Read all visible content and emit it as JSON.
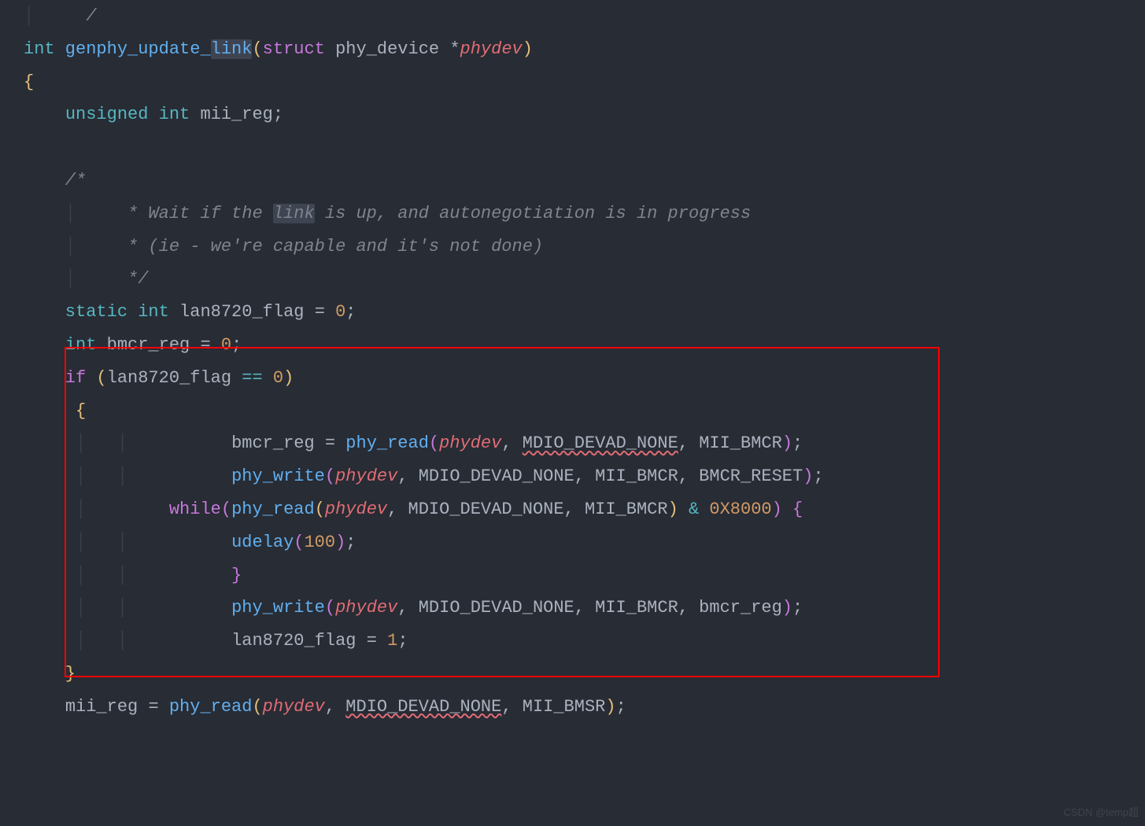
{
  "code": {
    "line0": "   /",
    "line1_int": "int",
    "line1_func": " genphy_update_",
    "line1_link": "link",
    "line1_p1": "(",
    "line1_struct": "struct",
    "line1_type": " phy_device ",
    "line1_star": "*",
    "line1_param": "phydev",
    "line1_p2": ")",
    "line2": "{",
    "line3_indent": "    ",
    "line3_unsigned": "unsigned int",
    "line3_var": " mii_reg",
    "line3_semi": ";",
    "line5_c": "    /*",
    "line6_c_pre": "     * Wait if the ",
    "line6_c_link": "link",
    "line6_c_post": " is up, and autonegotiation is in progress",
    "line7_c": "     * (ie - we're capable and it's not done)",
    "line8_c": "     */",
    "line9_static": "    static int",
    "line9_var": " lan8720_flag ",
    "line9_eq": "= ",
    "line9_num": "0",
    "line9_semi": ";",
    "line10_int": "    int",
    "line10_var": " bmcr_reg ",
    "line10_eq": "= ",
    "line10_num": "0",
    "line10_semi": ";",
    "line11_if": "    if ",
    "line11_p1": "(",
    "line11_var": "lan8720_flag ",
    "line11_eq": "== ",
    "line11_num": "0",
    "line11_p2": ")",
    "line12": "     {",
    "line13_indent": "          ",
    "line13_var": "bmcr_reg ",
    "line13_eq": "= ",
    "line13_func": "phy_read",
    "line13_p1": "(",
    "line13_param": "phydev",
    "line13_c1": ", ",
    "line13_const1": "MDIO_DEVAD_NONE",
    "line13_c2": ", ",
    "line13_const2": "MII_BMCR",
    "line13_p2": ")",
    "line13_semi": ";",
    "line14_indent": "          ",
    "line14_func": "phy_write",
    "line14_p1": "(",
    "line14_param": "phydev",
    "line14_c1": ", MDIO_DEVAD_NONE, MII_BMCR, BMCR_RESET",
    "line14_p2": ")",
    "line14_semi": ";",
    "line15_indent": "       ",
    "line15_while": "while",
    "line15_p1": "(",
    "line15_func": "phy_read",
    "line15_p2": "(",
    "line15_param": "phydev",
    "line15_c1": ", MDIO_DEVAD_NONE, MII_BMCR",
    "line15_p3": ")",
    "line15_amp": " & ",
    "line15_hex": "0X8000",
    "line15_p4": ")",
    "line15_brace": " {",
    "line16_indent": "          ",
    "line16_func": "udelay",
    "line16_p1": "(",
    "line16_num": "100",
    "line16_p2": ")",
    "line16_semi": ";",
    "line17": "          }",
    "line18_indent": "          ",
    "line18_func": "phy_write",
    "line18_p1": "(",
    "line18_param": "phydev",
    "line18_c1": ", MDIO_DEVAD_NONE, MII_BMCR, bmcr_reg",
    "line18_p2": ")",
    "line18_semi": ";",
    "line19_indent": "          ",
    "line19_var": "lan8720_flag ",
    "line19_eq": "= ",
    "line19_num": "1",
    "line19_semi": ";",
    "line20": "    }",
    "line21_indent": "    ",
    "line21_var": "mii_reg ",
    "line21_eq": "= ",
    "line21_func": "phy_read",
    "line21_p1": "(",
    "line21_param": "phydev",
    "line21_c1": ", ",
    "line21_const1": "MDIO_DEVAD_NONE",
    "line21_c2": ", MII_BMSR",
    "line21_p2": ")",
    "line21_semi": ";"
  },
  "watermark": "CSDN @temp超",
  "function_name": "genphy_update_link",
  "highlighted_word": "link",
  "red_box_lines": "if (lan8720_flag == 0) { ... lan8720_flag = 1; }"
}
